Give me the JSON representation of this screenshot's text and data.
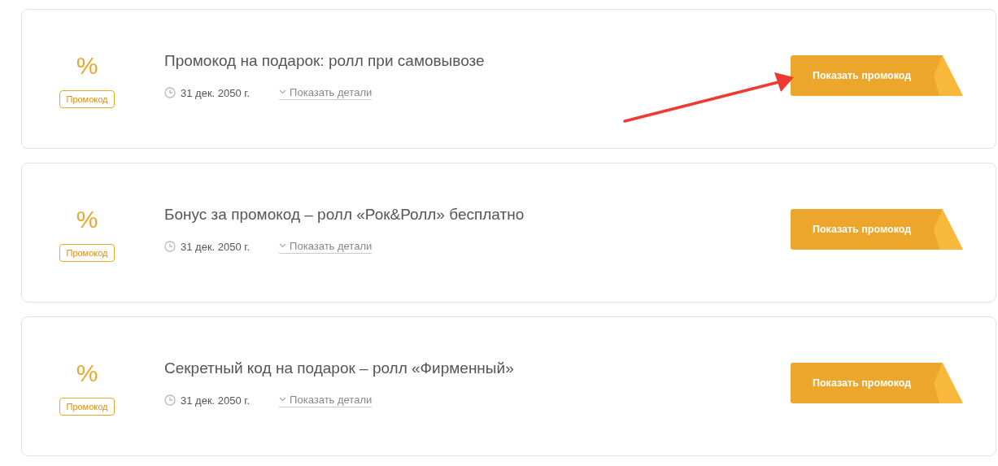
{
  "coupons": [
    {
      "symbol": "%",
      "badge": "Промокод",
      "title": "Промокод на подарок: ролл при самовывозе",
      "date": "31 дек. 2050 г.",
      "details": "Показать детали",
      "button": "Показать промокод",
      "arrow": true
    },
    {
      "symbol": "%",
      "badge": "Промокод",
      "title": "Бонус за промокод – ролл «Рок&Ролл» бесплатно",
      "date": "31 дек. 2050 г.",
      "details": "Показать детали",
      "button": "Показать промокод",
      "arrow": false
    },
    {
      "symbol": "%",
      "badge": "Промокод",
      "title": "Секретный код на подарок – ролл «Фирменный»",
      "date": "31 дек. 2050 г.",
      "details": "Показать детали",
      "button": "Показать промокод",
      "arrow": false
    }
  ]
}
